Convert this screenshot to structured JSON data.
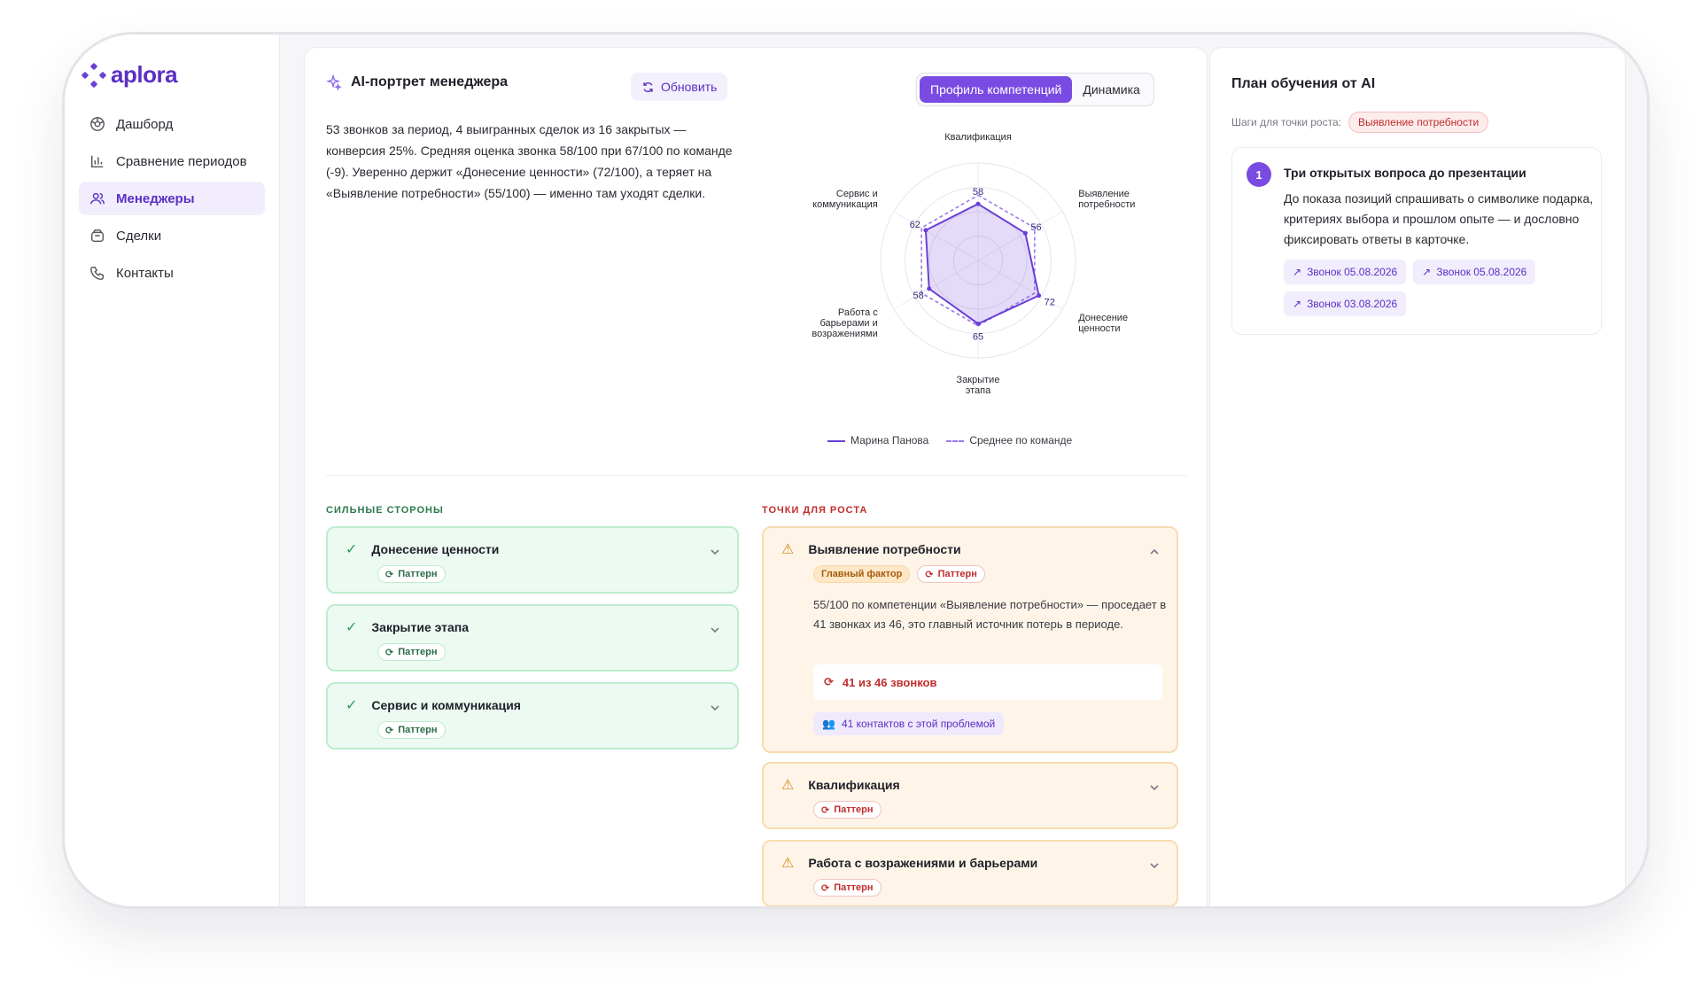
{
  "app": {
    "logo": "aplora"
  },
  "colors": {
    "accent": "#7a4be3",
    "strength": "#2b6b48",
    "growth": "#c22d2d"
  },
  "sidebar": {
    "items": [
      {
        "label": "Дашборд",
        "icon": "dashboard-icon"
      },
      {
        "label": "Сравнение периодов",
        "icon": "bar-chart-icon"
      },
      {
        "label": "Менеджеры",
        "icon": "users-icon",
        "active": true
      },
      {
        "label": "Сделки",
        "icon": "deals-icon"
      },
      {
        "label": "Контакты",
        "icon": "phone-icon"
      }
    ]
  },
  "portrait": {
    "title": "AI-портрет менеджера",
    "refresh_label": "Обновить",
    "summary": "53 звонков за период, 4 выигранных сделок из 16 закрытых — конверсия 25%. Средняя оценка звонка 58/100 при 67/100 по команде (-9). Уверенно держит «Донесение ценности» (72/100), а теряет на «Выявление потребности» (55/100) — именно там уходят сделки.",
    "tabs": [
      "Профиль компетенций",
      "Динамика"
    ],
    "active_tab": "Профиль компетенций"
  },
  "chart_data": {
    "type": "radar",
    "axes": [
      "Квалификация",
      "Выявление потребности",
      "Донесение ценности",
      "Закрытие этапа",
      "Работа с барьерами и возражениями",
      "Сервис и коммуникация"
    ],
    "series": [
      {
        "name": "Марина Панова",
        "values": [
          58,
          56,
          72,
          65,
          58,
          62
        ]
      },
      {
        "name": "Среднее по команде",
        "values": [
          67,
          67,
          67,
          67,
          67,
          67
        ]
      }
    ],
    "rmax": 100
  },
  "strengths": {
    "label": "СИЛЬНЫЕ СТОРОНЫ",
    "items": [
      {
        "title": "Донесение ценности",
        "badge": "Паттерн"
      },
      {
        "title": "Закрытие этапа",
        "badge": "Паттерн"
      },
      {
        "title": "Сервис и коммуникация",
        "badge": "Паттерн"
      }
    ]
  },
  "growth": {
    "label": "ТОЧКИ ДЛЯ РОСТА",
    "expanded": {
      "title": "Выявление потребности",
      "badge_main": "Главный фактор",
      "badge_pattern": "Паттерн",
      "body": "55/100 по компетенции «Выявление потребности» — проседает в 41 звонках из 46, это главный источник потерь в периоде.",
      "count": "41 из 46 звонков",
      "contacts": "41 контактов с этой проблемой"
    },
    "items": [
      {
        "title": "Квалификация",
        "badge": "Паттерн"
      },
      {
        "title": "Работа с возражениями и барьерами",
        "badge": "Паттерн"
      }
    ]
  },
  "plan": {
    "title": "План обучения от AI",
    "steps_label": "Шаги для точки роста:",
    "growth_point": "Выявление потребности",
    "step": {
      "num": "1",
      "title": "Три открытых вопроса до презентации",
      "text": "До показа позиций спрашивать о символике подарка, критериях выбора и прошлом опыте — и дословно фиксировать ответы в карточке.",
      "calls": [
        "Звонок 05.08.2026",
        "Звонок 05.08.2026",
        "Звонок 03.08.2026"
      ]
    }
  }
}
